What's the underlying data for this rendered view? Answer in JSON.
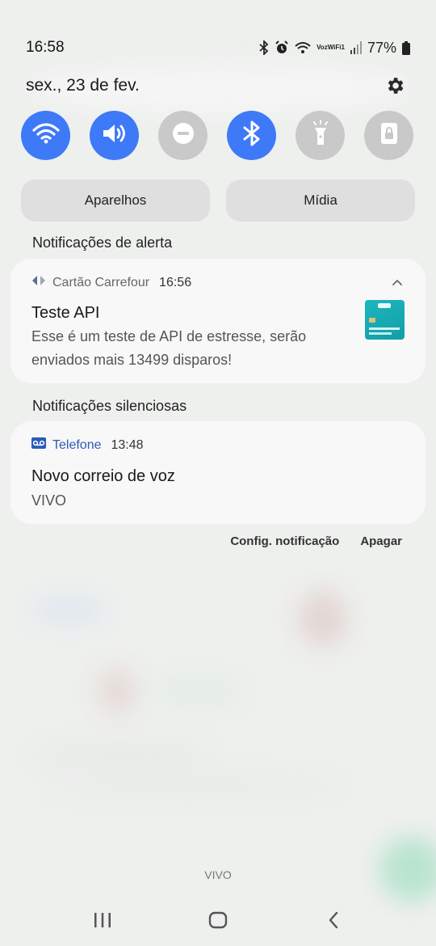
{
  "status_bar": {
    "time": "16:58",
    "voz_line1": "Voz",
    "voz_line2": "WiFi1",
    "battery": "77%",
    "icons": [
      "bluetooth-icon",
      "alarm-icon",
      "wifi-calling-icon",
      "signal-icon",
      "battery-icon"
    ]
  },
  "header": {
    "date": "sex., 23 de fev.",
    "settings_icon": "gear-icon"
  },
  "quick_toggles": [
    {
      "name": "wifi",
      "state": "on",
      "icon": "wifi-icon"
    },
    {
      "name": "sound",
      "state": "on",
      "icon": "speaker-icon"
    },
    {
      "name": "do-not-disturb",
      "state": "off",
      "icon": "minus-circle-icon"
    },
    {
      "name": "bluetooth",
      "state": "on",
      "icon": "bluetooth-icon"
    },
    {
      "name": "flashlight",
      "state": "off",
      "icon": "flashlight-icon"
    },
    {
      "name": "secure-folder",
      "state": "off",
      "icon": "lock-icon"
    }
  ],
  "colors": {
    "toggle_on": "#3e79f7",
    "toggle_off": "#c8c9c8",
    "accent_blue": "#2a5bb8"
  },
  "media": {
    "devices_label": "Aparelhos",
    "media_label": "Mídia"
  },
  "sections": {
    "alert_title": "Notificações de alerta",
    "silent_title": "Notificações silenciosas"
  },
  "notifications": [
    {
      "app": "Cartão Carrefour",
      "time": "16:56",
      "title": "Teste API",
      "body": "Esse é um teste de API de estresse, serão enviados mais 13499 disparos!",
      "icon": "carrefour-logo-icon"
    },
    {
      "app": "Telefone",
      "time": "13:48",
      "title": "Novo correio de voz",
      "body": "VIVO",
      "icon": "voicemail-icon"
    }
  ],
  "actions": {
    "settings_label": "Config. notificação",
    "clear_label": "Apagar"
  },
  "footer": {
    "carrier": "VIVO"
  }
}
